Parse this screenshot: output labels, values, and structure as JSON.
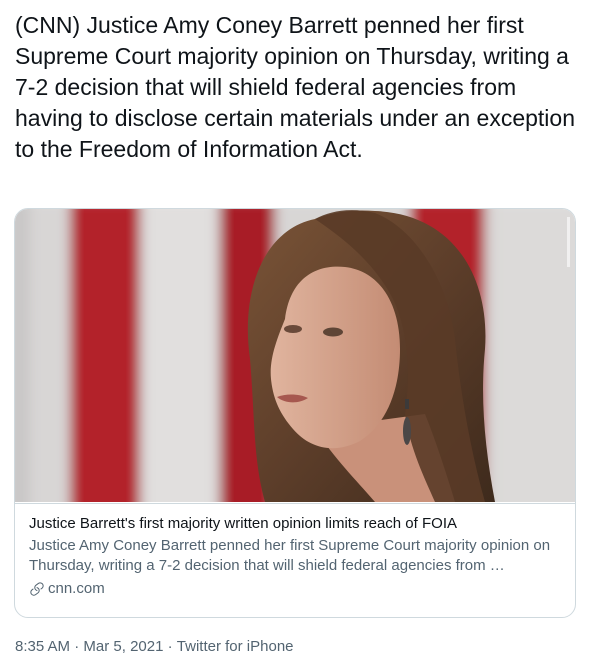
{
  "tweet": {
    "text": "(CNN) Justice Amy Coney Barrett penned her first Supreme Court majority opinion on Thursday, writing a 7-2 decision that will shield federal agencies from having to disclose certain materials under an exception to the Freedom of Information Act."
  },
  "card": {
    "image_alt": "Justice Amy Coney Barrett in front of a flag",
    "title": "Justice Barrett's first majority written opinion limits reach of FOIA",
    "description": "Justice Amy Coney Barrett penned her first Supreme Court majority opinion on Thursday, writing a 7-2 decision that will shield federal agencies from …",
    "domain": "cnn.com",
    "link_icon": "link-icon"
  },
  "meta": {
    "time": "8:35 AM",
    "separator": "·",
    "date": "Mar 5, 2021",
    "source": "Twitter for iPhone"
  },
  "colors": {
    "text": "#0f1419",
    "secondary": "#536471",
    "border": "#cfd9de",
    "flag_red": "#b3202a",
    "flag_white": "#d9d7d6"
  }
}
